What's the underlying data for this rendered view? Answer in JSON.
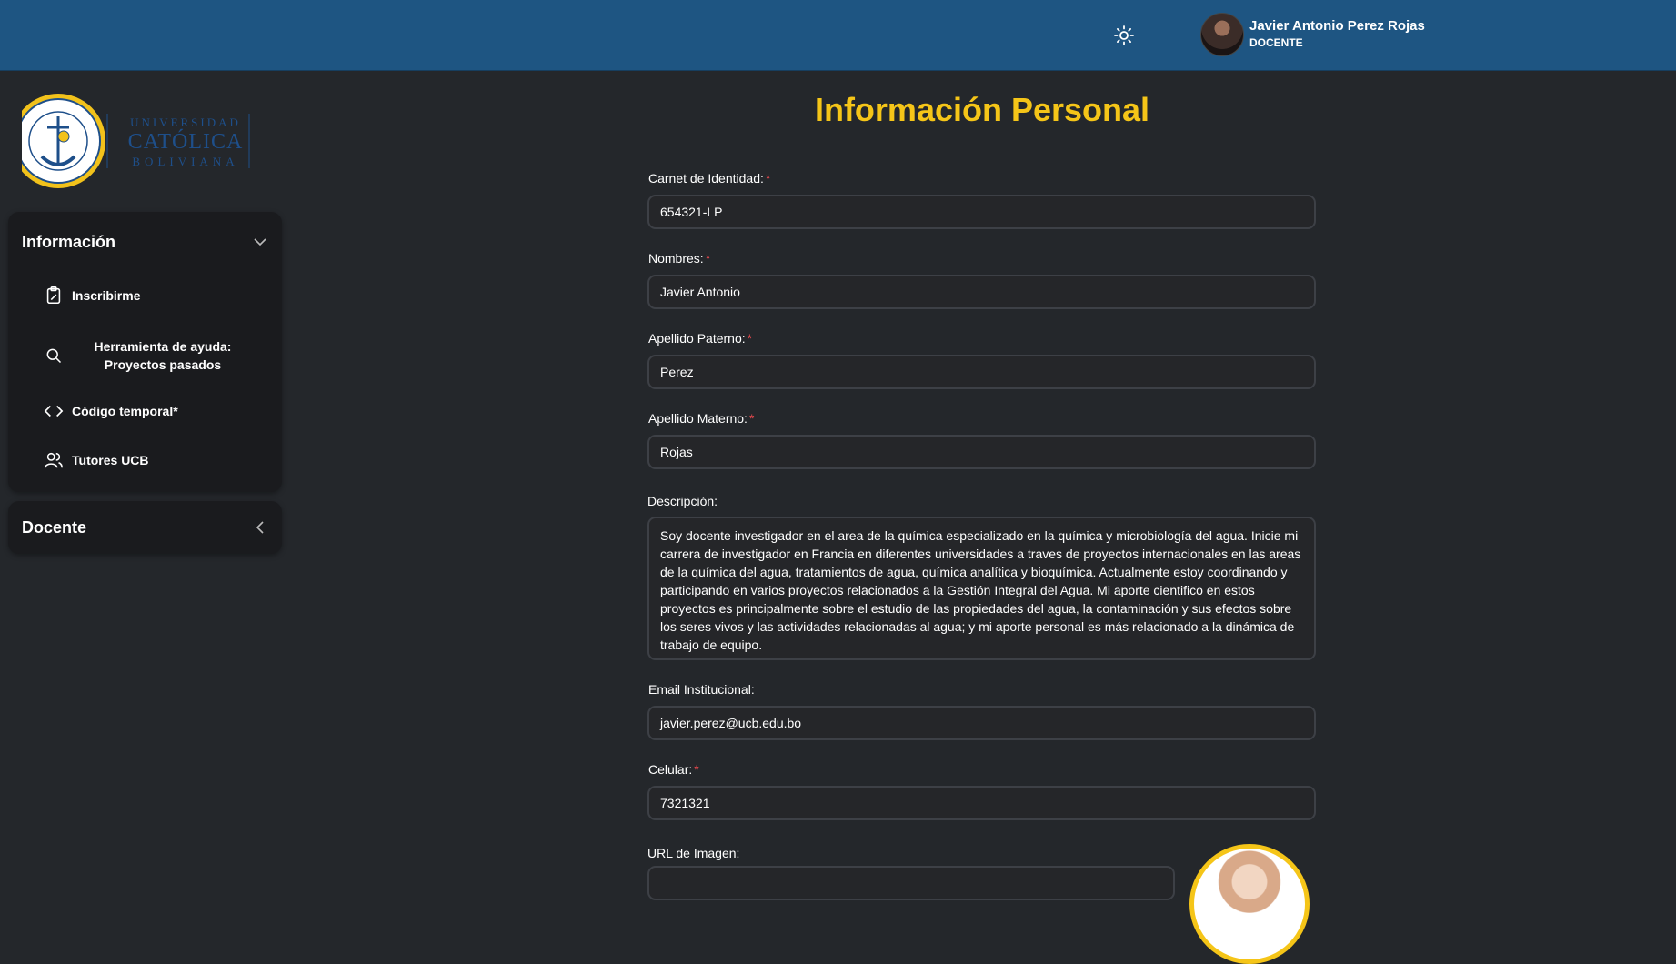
{
  "header": {
    "user_name": "Javier Antonio Perez Rojas",
    "user_role": "DOCENTE",
    "theme_icon": "sun-icon",
    "brand_color": "#1e5582"
  },
  "logo": {
    "line1": "UNIVERSIDAD",
    "line2": "CATÓLICA",
    "line3": "BOLIVIANA"
  },
  "sidebar": {
    "sections": [
      {
        "title": "Información",
        "expanded": true,
        "items": [
          {
            "label": "Inscribirme",
            "icon": "clipboard-icon"
          },
          {
            "label": "Herramienta de ayuda: Proyectos pasados",
            "icon": "search-icon"
          },
          {
            "label": "Código temporal*",
            "icon": "code-icon"
          },
          {
            "label": "Tutores UCB",
            "icon": "users-icon"
          }
        ]
      },
      {
        "title": "Docente",
        "expanded": false,
        "items": []
      }
    ]
  },
  "main": {
    "title": "Información Personal",
    "accent_color": "#f5c518",
    "fields": {
      "ci": {
        "label": "Carnet de Identidad:",
        "required": "*",
        "value": "654321-LP"
      },
      "nombres": {
        "label": "Nombres:",
        "required": "*",
        "value": "Javier Antonio"
      },
      "paterno": {
        "label": "Apellido Paterno:",
        "required": "*",
        "value": "Perez"
      },
      "materno": {
        "label": "Apellido Materno:",
        "required": "*",
        "value": "Rojas"
      },
      "descripcion": {
        "label": "Descripción:",
        "value": "Soy docente investigador en el area de la química especializado en la química y microbiología del agua. Inicie mi carrera de investigador en Francia en diferentes universidades a traves de proyectos internacionales en las areas de la química del agua, tratamientos de agua, química analítica y bioquímica. Actualmente estoy coordinando y participando en varios proyectos relacionados a la Gestión Integral del Agua. Mi aporte cientifico en estos proyectos es principalmente sobre el estudio de las propiedades del agua, la contaminación y sus efectos sobre los seres vivos y las actividades relacionadas al agua; y mi aporte personal es más relacionado a la dinámica de trabajo de equipo."
      },
      "email": {
        "label": "Email Institucional:",
        "value": "javier.perez@ucb.edu.bo"
      },
      "celular": {
        "label": "Celular:",
        "required": "*",
        "value": "7321321"
      },
      "imagen": {
        "label": "URL de Imagen:"
      }
    }
  }
}
